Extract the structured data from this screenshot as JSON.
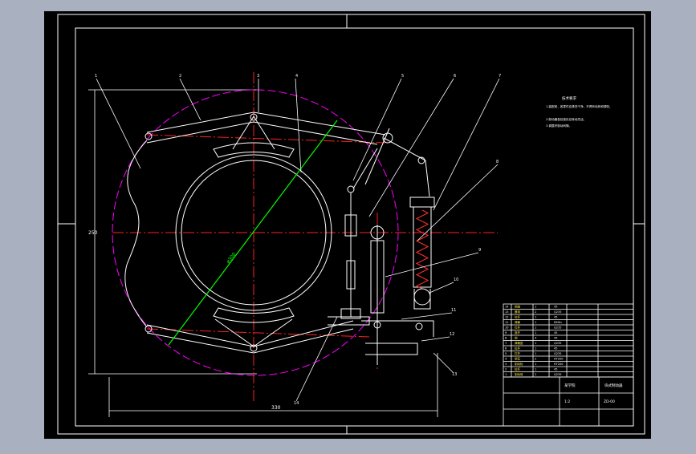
{
  "colors": {
    "frame_bg": "#a9b1c0",
    "canvas": "#000000",
    "line": "#ffffff",
    "center_line": "#ff2020",
    "dim_dash": "#ff00ff",
    "diag": "#00ff00"
  },
  "drawing": {
    "notes_title": "技术要求",
    "notes": [
      "1.装配前，各零件应清洗干净，不得有毛刺和锈斑。",
      "2.制动器各铰接处应转动灵活。",
      "3.调整好制动间隙。"
    ],
    "dimensions": {
      "width": "330",
      "height": "250",
      "diagonal": "ø300"
    },
    "balloons": [
      "1",
      "2",
      "3",
      "4",
      "5",
      "6",
      "7",
      "8",
      "9",
      "10",
      "11",
      "12",
      "13",
      "14"
    ]
  },
  "title_block": {
    "company": "某学院",
    "drawing_name": "块式制动器",
    "drawing_no": "ZD-00",
    "scale": "1:2",
    "rows": [
      [
        "14",
        "销轴",
        "1",
        "45"
      ],
      [
        "13",
        "螺母",
        "2",
        "Q235"
      ],
      [
        "12",
        "拉杆",
        "1",
        "45"
      ],
      [
        "11",
        "弹簧",
        "1",
        "65Mn"
      ],
      [
        "10",
        "杠杆",
        "1",
        "Q235"
      ],
      [
        "9",
        "推杆",
        "1",
        "45"
      ],
      [
        "8",
        "销",
        "4",
        "45"
      ],
      [
        "7",
        "弹簧座",
        "1",
        "Q235"
      ],
      [
        "6",
        "拉杆",
        "1",
        "45"
      ],
      [
        "5",
        "杠杆",
        "1",
        "Q235"
      ],
      [
        "4",
        "闸瓦",
        "2",
        "HT200"
      ],
      [
        "3",
        "制动轮",
        "1",
        "HT200"
      ],
      [
        "2",
        "拉杆",
        "1",
        "45"
      ],
      [
        "1",
        "制动臂",
        "2",
        "Q235"
      ]
    ]
  }
}
